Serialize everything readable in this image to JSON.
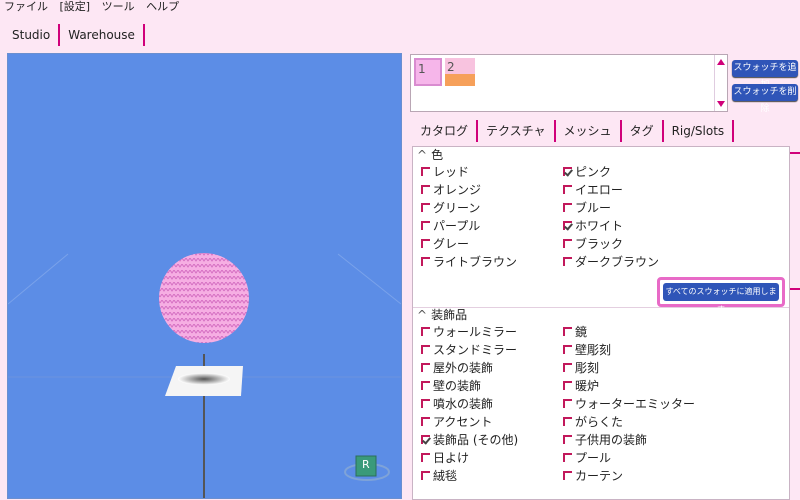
{
  "menu": [
    "ファイル",
    "[設定]",
    "ツール",
    "ヘルプ"
  ],
  "top_tabs": [
    "Studio",
    "Warehouse"
  ],
  "viewport": {
    "r_badge": "R"
  },
  "swatches": [
    "1",
    "2"
  ],
  "buttons": {
    "add_swatch": "スウォッチを追加",
    "delete_swatch": "スウォッチを削除",
    "apply_all": "すべてのスウォッチに適用します"
  },
  "tabs": [
    "カタログ",
    "テクスチャ",
    "メッシュ",
    "タグ",
    "Rig/Slots"
  ],
  "color_section": {
    "title": "色",
    "left": [
      {
        "label": "レッド",
        "checked": false
      },
      {
        "label": "オレンジ",
        "checked": false
      },
      {
        "label": "グリーン",
        "checked": false
      },
      {
        "label": "パープル",
        "checked": false
      },
      {
        "label": "グレー",
        "checked": false
      },
      {
        "label": "ライトブラウン",
        "checked": false
      }
    ],
    "right": [
      {
        "label": "ピンク",
        "checked": true
      },
      {
        "label": "イエロー",
        "checked": false
      },
      {
        "label": "ブルー",
        "checked": false
      },
      {
        "label": "ホワイト",
        "checked": true
      },
      {
        "label": "ブラック",
        "checked": false
      },
      {
        "label": "ダークブラウン",
        "checked": false
      }
    ]
  },
  "decor_section": {
    "title": "装飾品",
    "left": [
      {
        "label": "ウォールミラー",
        "checked": false
      },
      {
        "label": "スタンドミラー",
        "checked": false
      },
      {
        "label": "屋外の装飾",
        "checked": false
      },
      {
        "label": "壁の装飾",
        "checked": false
      },
      {
        "label": "噴水の装飾",
        "checked": false
      },
      {
        "label": "アクセント",
        "checked": false
      },
      {
        "label": "装飾品 (その他)",
        "checked": true
      },
      {
        "label": "日よけ",
        "checked": false
      },
      {
        "label": "絨毯",
        "checked": false
      }
    ],
    "right": [
      {
        "label": "鏡",
        "checked": false
      },
      {
        "label": "壁彫刻",
        "checked": false
      },
      {
        "label": "彫刻",
        "checked": false
      },
      {
        "label": "暖炉",
        "checked": false
      },
      {
        "label": "ウォーターエミッター",
        "checked": false
      },
      {
        "label": "がらくた",
        "checked": false
      },
      {
        "label": "子供用の装飾",
        "checked": false
      },
      {
        "label": "プール",
        "checked": false
      },
      {
        "label": "カーテン",
        "checked": false
      }
    ]
  }
}
